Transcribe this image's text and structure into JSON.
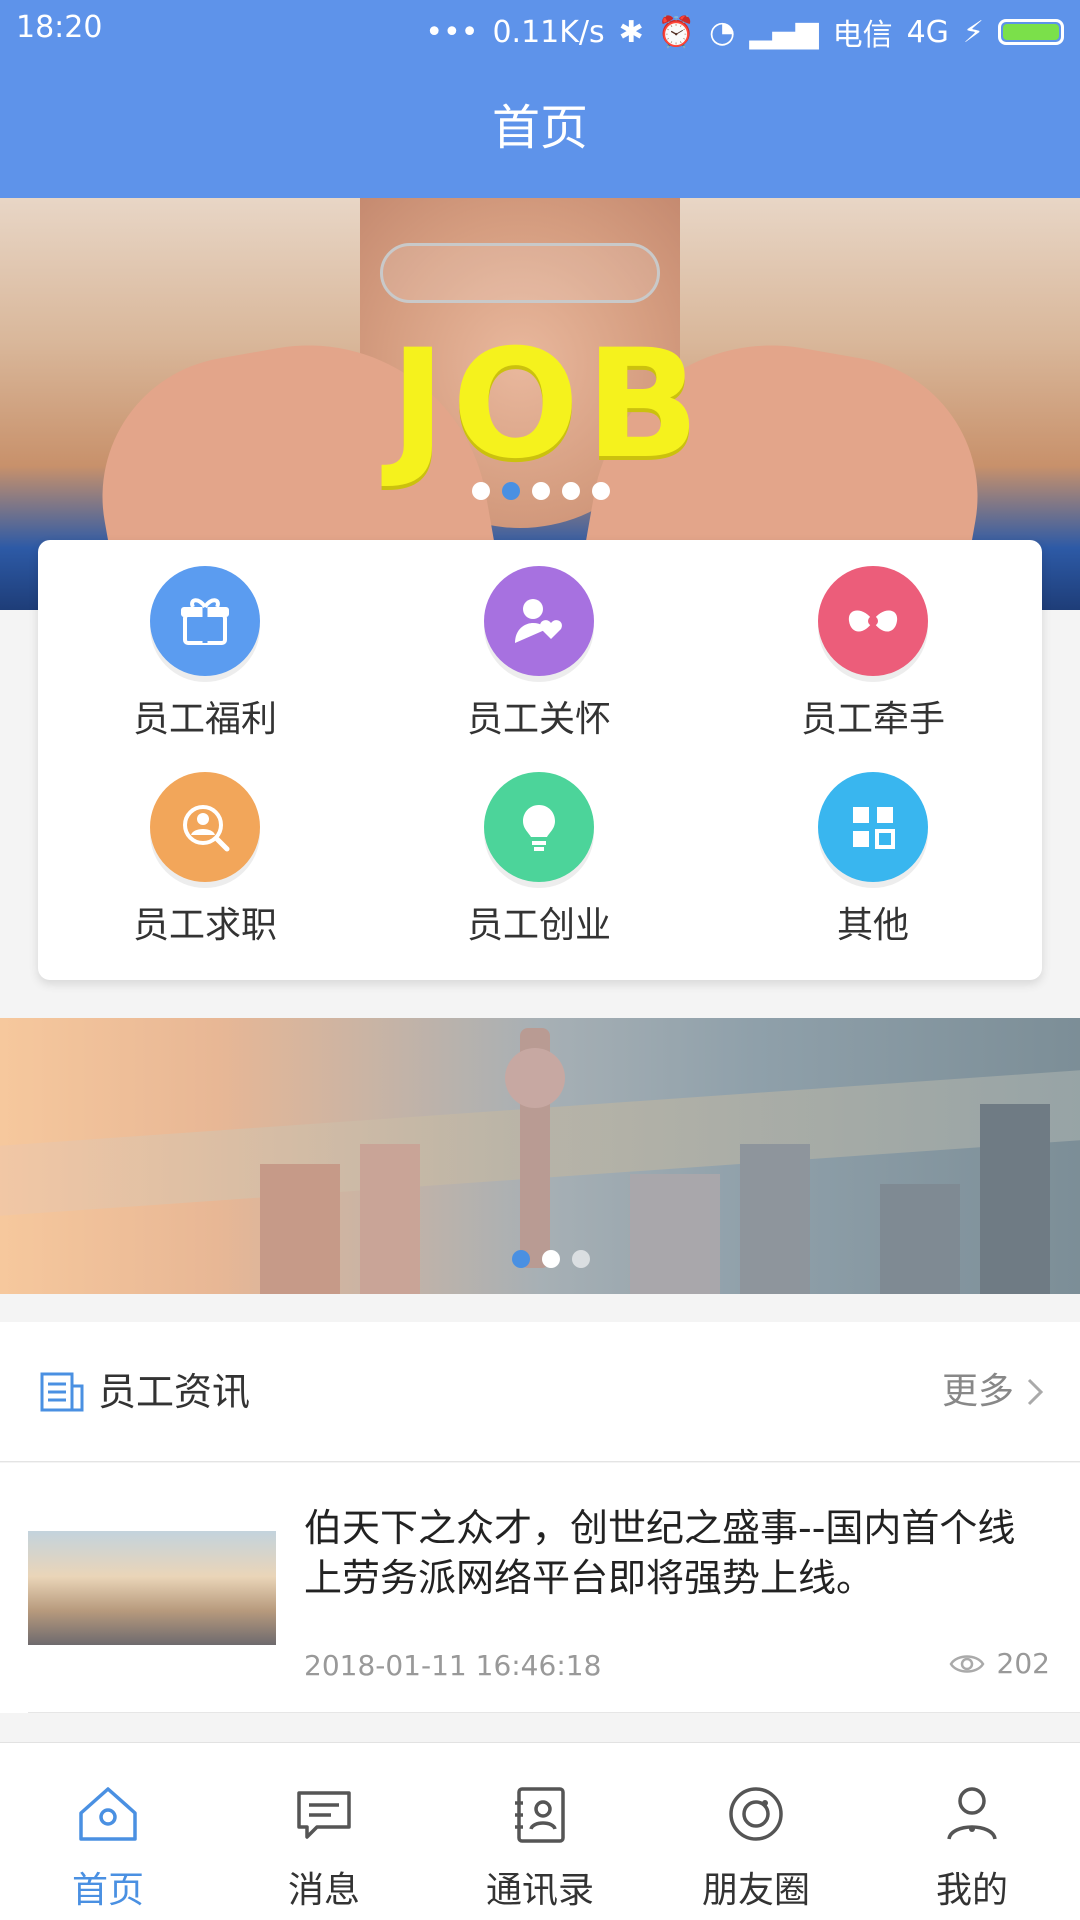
{
  "status_bar": {
    "time": "18:20",
    "dots": "•••",
    "net_speed": "0.11K/s",
    "carrier": "电信",
    "network": "4G"
  },
  "header": {
    "title": "首页"
  },
  "banner_top": {
    "text": "JOB",
    "slides": 5,
    "active_index": 1
  },
  "menu": {
    "items": [
      {
        "label": "员工福利",
        "color": "#5b9cf0",
        "icon": "gift-icon"
      },
      {
        "label": "员工关怀",
        "color": "#a771e0",
        "icon": "person-heart-icon"
      },
      {
        "label": "员工牵手",
        "color": "#ec5d7a",
        "icon": "bow-icon"
      },
      {
        "label": "员工求职",
        "color": "#f2a65a",
        "icon": "person-search-icon"
      },
      {
        "label": "员工创业",
        "color": "#4cd49a",
        "icon": "lightbulb-icon"
      },
      {
        "label": "其他",
        "color": "#39b6ef",
        "icon": "grid-icon"
      }
    ]
  },
  "banner_bottom": {
    "slides": 3,
    "active_index": 0
  },
  "news": {
    "section_title": "员工资讯",
    "more_label": "更多",
    "items": [
      {
        "headline": "伯天下之众才，创世纪之盛事--国内首个线上劳务派网络平台即将强势上线。",
        "date": "2018-01-11 16:46:18",
        "views": "202"
      }
    ]
  },
  "bottom_nav": {
    "items": [
      {
        "label": "首页",
        "icon": "home-icon",
        "active": true
      },
      {
        "label": "消息",
        "icon": "message-icon",
        "active": false
      },
      {
        "label": "通讯录",
        "icon": "contacts-icon",
        "active": false
      },
      {
        "label": "朋友圈",
        "icon": "moments-icon",
        "active": false
      },
      {
        "label": "我的",
        "icon": "profile-icon",
        "active": false
      }
    ]
  },
  "colors": {
    "primary": "#5e93ea",
    "accent_active": "#4a90e2"
  }
}
